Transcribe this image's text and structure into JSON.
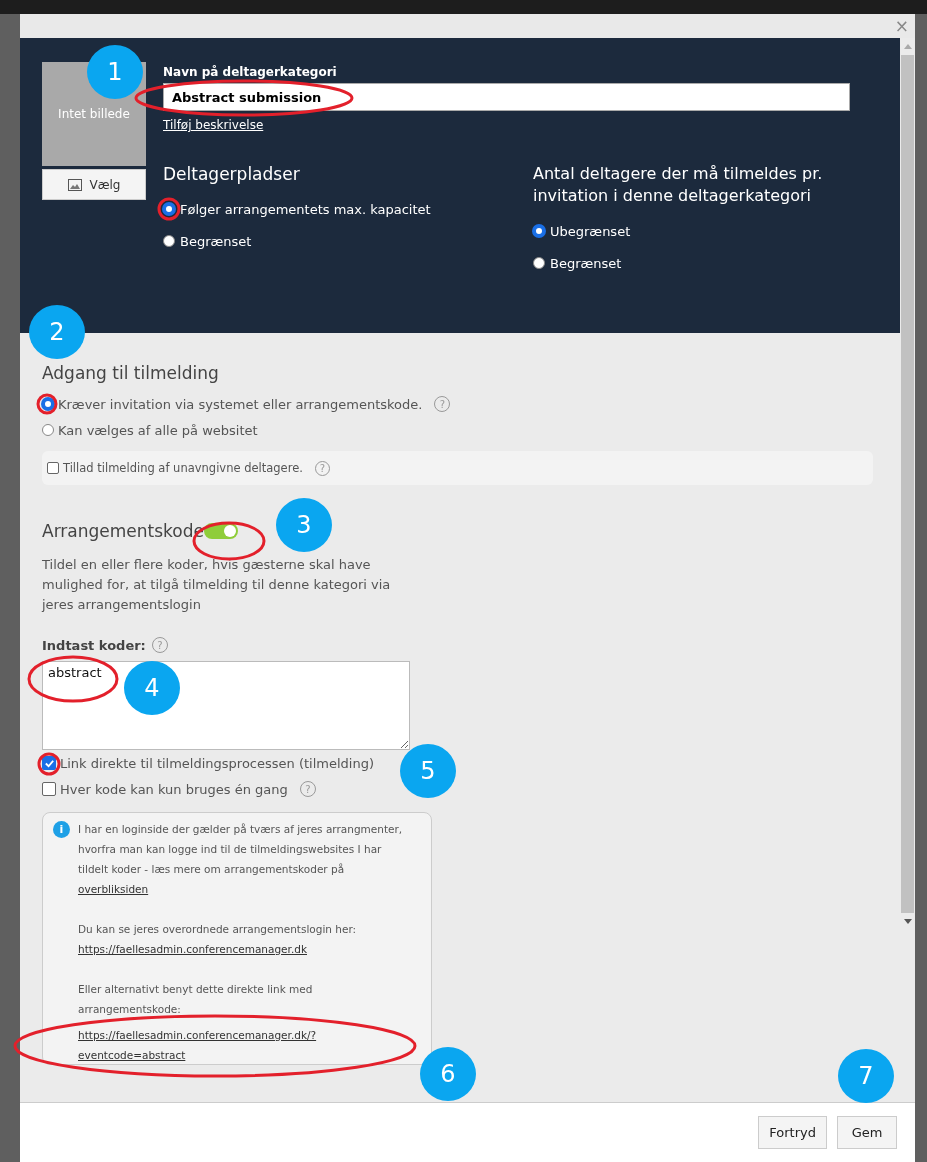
{
  "dialog": {
    "close": "×"
  },
  "header": {
    "image_placeholder": "Intet billede",
    "choose_button": "Vælg",
    "name_label": "Navn på deltagerkategori",
    "name_value": "Abstract submission",
    "add_description": "Tilføj beskrivelse",
    "seats": {
      "title": "Deltagerpladser",
      "options": [
        {
          "label": "Følger arrangementets max. kapacitet",
          "selected": true
        },
        {
          "label": "Begrænset",
          "selected": false
        }
      ]
    },
    "per_invitation": {
      "title": "Antal deltagere der må tilmeldes pr. invitation i denne deltagerkategori",
      "options": [
        {
          "label": "Ubegrænset",
          "selected": true
        },
        {
          "label": "Begrænset",
          "selected": false
        }
      ]
    }
  },
  "access": {
    "title": "Adgang til tilmelding",
    "options": [
      {
        "label": "Kræver invitation via systemet eller arrangementskode.",
        "selected": true,
        "help": "?"
      },
      {
        "label": "Kan vælges af alle på websitet",
        "selected": false
      }
    ],
    "anonymous": {
      "label": "Tillad tilmelding af unavngivne deltagere.",
      "checked": false,
      "help": "?"
    }
  },
  "event_code": {
    "title": "Arrangementskode",
    "on": true,
    "description": "Tildel en eller flere koder, hvis gæsterne skal have mulighed for, at tilgå tilmelding til denne kategori via jeres arrangementslogin",
    "codes_label": "Indtast koder:",
    "codes_help": "?",
    "codes_value": "abstract",
    "checks": [
      {
        "label": "Link direkte til tilmeldingsprocessen (tilmelding)",
        "checked": true
      },
      {
        "label": "Hver kode kan kun bruges én gang",
        "checked": false,
        "help": "?"
      }
    ],
    "info": {
      "icon": "i",
      "p1": "I har en loginside der gælder på tværs af jeres arrangmenter, hvorfra man kan logge ind til de tilmeldingswebsites I har tildelt koder - læs mere om arrangementskoder på",
      "p1_link": "overbliksiden",
      "p2": "Du kan se jeres overordnede arrangementslogin her:",
      "p2_link": "https://faellesadmin.conferencemanager.dk",
      "p3": "Eller alternativt benyt dette direkte link med arrangementskode:",
      "p3_link": "https://faellesadmin.conferencemanager.dk/?eventcode=abstract"
    }
  },
  "footer": {
    "buttons": [
      "Fortryd",
      "Gem"
    ]
  },
  "callouts": [
    "1",
    "2",
    "3",
    "4",
    "5",
    "6",
    "7"
  ]
}
